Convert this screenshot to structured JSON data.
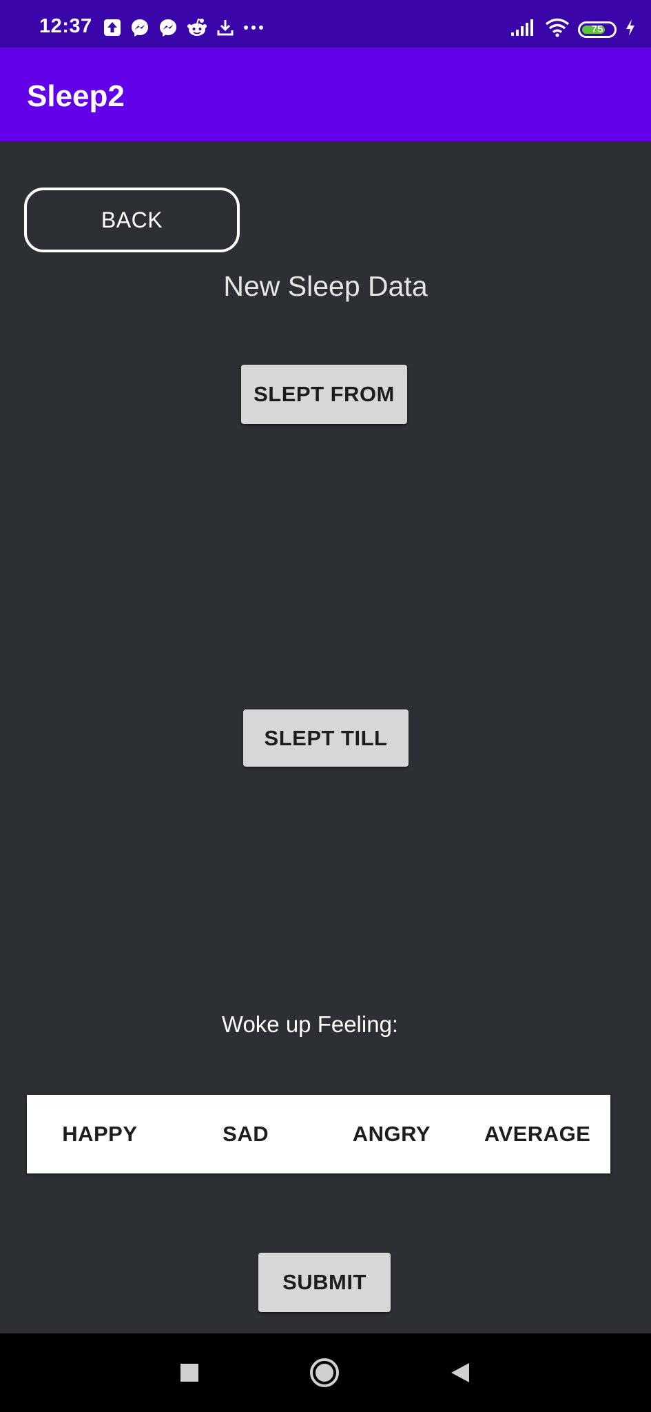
{
  "status_bar": {
    "time": "12:37",
    "battery_level": "75",
    "battery_fraction": 0.75,
    "icons": [
      "upload-icon",
      "messenger-icon",
      "messenger-icon",
      "reddit-icon",
      "download-icon",
      "more-dots-icon",
      "signal-icon",
      "wifi-icon",
      "battery-icon",
      "charging-icon"
    ]
  },
  "app_bar": {
    "title": "Sleep2"
  },
  "back_button": {
    "label": "BACK"
  },
  "screen": {
    "title": "New Sleep Data"
  },
  "slept_from_button": {
    "label": "SLEPT FROM"
  },
  "slept_till_button": {
    "label": "SLEPT TILL"
  },
  "feeling": {
    "label": "Woke up Feeling:",
    "options": [
      "HAPPY",
      "SAD",
      "ANGRY",
      "AVERAGE"
    ]
  },
  "submit_button": {
    "label": "SUBMIT"
  },
  "nav_bar": {
    "icons": [
      "recents-icon",
      "home-icon",
      "back-icon"
    ]
  },
  "colors": {
    "status_bar": "#3a06a9",
    "app_bar": "#6200ea",
    "background": "#2c2f34",
    "button": "#d6d7d7"
  }
}
